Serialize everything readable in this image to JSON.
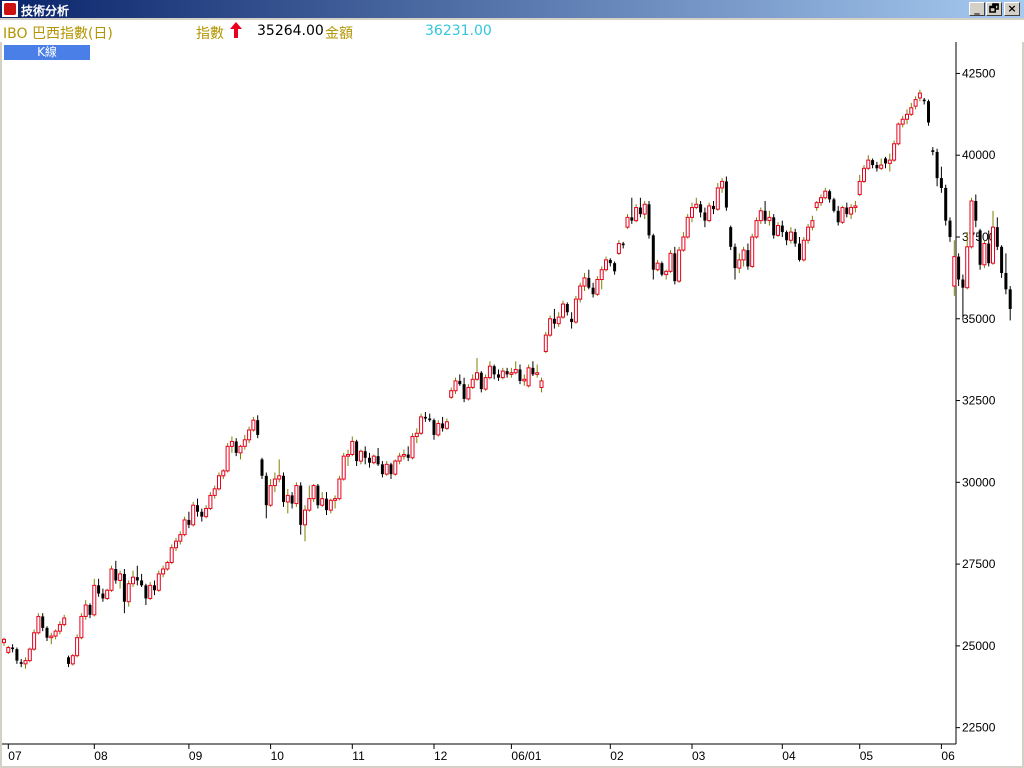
{
  "window": {
    "title": "技術分析"
  },
  "window_controls": [
    "_",
    "🗗",
    "×"
  ],
  "infobar": {
    "name": "IBO 巴西指數(日)",
    "index_label": "指數",
    "index_value": "35264.00",
    "amount_label": "金額",
    "amount_value": "36231.00"
  },
  "tab": {
    "label": "K線"
  },
  "colors": {
    "up": "#e8001e",
    "down": "#000000",
    "doji": "#808000",
    "label": "#b39500",
    "amount": "#33c6dd"
  },
  "chart_data": {
    "type": "candlestick",
    "title": "IBO 巴西指數(日)",
    "xlabel": "",
    "ylabel": "",
    "ylim": [
      22000,
      43400
    ],
    "y_ticks": [
      22500,
      25000,
      27500,
      30000,
      32500,
      35000,
      37500,
      40000,
      42500
    ],
    "y_axis_side": "right",
    "grid": false,
    "x_ticks": [
      "07",
      "08",
      "09",
      "10",
      "11",
      "12",
      "06/01",
      "02",
      "03",
      "04",
      "05",
      "06"
    ],
    "x_tick_index": [
      1,
      21,
      43,
      62,
      81,
      100,
      118,
      141,
      160,
      181,
      199,
      218
    ],
    "candles": [
      [
        25100,
        25250,
        25000,
        25200
      ],
      [
        24800,
        25000,
        24750,
        24950
      ],
      [
        24950,
        25050,
        24800,
        24900
      ],
      [
        24900,
        24950,
        24450,
        24550
      ],
      [
        24500,
        24600,
        24350,
        24450
      ],
      [
        24450,
        24650,
        24300,
        24550
      ],
      [
        24550,
        24950,
        24500,
        24900
      ],
      [
        24900,
        25500,
        24850,
        25400
      ],
      [
        25400,
        26000,
        25350,
        25900
      ],
      [
        25900,
        26000,
        25450,
        25550
      ],
      [
        25550,
        25600,
        25150,
        25250
      ],
      [
        25250,
        25400,
        25050,
        25300
      ],
      [
        25300,
        25500,
        25200,
        25450
      ],
      [
        25450,
        25750,
        25350,
        25650
      ],
      [
        25650,
        25950,
        25600,
        25850
      ],
      [
        24650,
        24700,
        24350,
        24450
      ],
      [
        24450,
        24750,
        24400,
        24700
      ],
      [
        24700,
        25350,
        24650,
        25250
      ],
      [
        25250,
        26000,
        25200,
        25900
      ],
      [
        25900,
        26400,
        25800,
        26250
      ],
      [
        26250,
        26300,
        25850,
        25950
      ],
      [
        25950,
        27050,
        25900,
        26850
      ],
      [
        26850,
        27050,
        26500,
        26600
      ],
      [
        26600,
        26750,
        26350,
        26450
      ],
      [
        26450,
        26750,
        26400,
        26700
      ],
      [
        26700,
        27450,
        26650,
        27350
      ],
      [
        27350,
        27600,
        26900,
        27000
      ],
      [
        27000,
        27300,
        26750,
        27200
      ],
      [
        27200,
        27350,
        26000,
        26350
      ],
      [
        26350,
        27000,
        26200,
        26900
      ],
      [
        26900,
        27300,
        26800,
        27100
      ],
      [
        27100,
        27450,
        26850,
        27000
      ],
      [
        27000,
        27200,
        26800,
        26850
      ],
      [
        26850,
        26900,
        26250,
        26450
      ],
      [
        26450,
        26950,
        26400,
        26850
      ],
      [
        26850,
        27000,
        26550,
        26700
      ],
      [
        26700,
        27300,
        26650,
        27200
      ],
      [
        27200,
        27450,
        27100,
        27350
      ],
      [
        27350,
        27600,
        27300,
        27550
      ],
      [
        27550,
        28100,
        27500,
        28000
      ],
      [
        28000,
        28300,
        27900,
        28200
      ],
      [
        28200,
        28500,
        28100,
        28400
      ],
      [
        28400,
        28950,
        28350,
        28850
      ],
      [
        28850,
        29100,
        28600,
        28700
      ],
      [
        28700,
        29400,
        28650,
        29300
      ],
      [
        29300,
        29500,
        28950,
        29100
      ],
      [
        29100,
        29200,
        28800,
        28950
      ],
      [
        28950,
        29300,
        28900,
        29200
      ],
      [
        29200,
        29700,
        29150,
        29600
      ],
      [
        29600,
        29900,
        29500,
        29800
      ],
      [
        29800,
        30300,
        29750,
        30200
      ],
      [
        30200,
        30400,
        30100,
        30350
      ],
      [
        30350,
        31200,
        30300,
        31100
      ],
      [
        31100,
        31400,
        30900,
        31250
      ],
      [
        31250,
        31350,
        30800,
        30900
      ],
      [
        30900,
        31150,
        30700,
        31100
      ],
      [
        31100,
        31450,
        31000,
        31300
      ],
      [
        31300,
        31700,
        31200,
        31600
      ],
      [
        31600,
        32000,
        31550,
        31900
      ],
      [
        31900,
        32050,
        31350,
        31450
      ],
      [
        30700,
        30750,
        30100,
        30200
      ],
      [
        30200,
        30300,
        28900,
        29300
      ],
      [
        29300,
        30100,
        29250,
        29900
      ],
      [
        29900,
        30300,
        29700,
        30100
      ],
      [
        30100,
        30700,
        30000,
        30200
      ],
      [
        30200,
        30300,
        29250,
        29400
      ],
      [
        29400,
        29800,
        29050,
        29600
      ],
      [
        29600,
        29700,
        29200,
        29350
      ],
      [
        29350,
        30000,
        29250,
        29900
      ],
      [
        29900,
        30000,
        28400,
        28700
      ],
      [
        28700,
        29300,
        28200,
        29150
      ],
      [
        29150,
        29900,
        29100,
        29500
      ],
      [
        29500,
        29950,
        29400,
        29900
      ],
      [
        29900,
        29950,
        29200,
        29300
      ],
      [
        29300,
        29700,
        29250,
        29500
      ],
      [
        29500,
        29700,
        29000,
        29150
      ],
      [
        29150,
        29500,
        29050,
        29450
      ],
      [
        29450,
        29600,
        29200,
        29500
      ],
      [
        29500,
        30200,
        29450,
        30100
      ],
      [
        30100,
        30900,
        30050,
        30800
      ],
      [
        30800,
        31000,
        30500,
        30850
      ],
      [
        30850,
        31400,
        30800,
        31250
      ],
      [
        31250,
        31300,
        30500,
        30650
      ],
      [
        30650,
        31000,
        30550,
        30950
      ],
      [
        30950,
        31100,
        30550,
        30750
      ],
      [
        30750,
        30900,
        30450,
        30600
      ],
      [
        30600,
        30850,
        30550,
        30800
      ],
      [
        30800,
        31050,
        30500,
        30550
      ],
      [
        30550,
        30650,
        30150,
        30250
      ],
      [
        30250,
        30650,
        30200,
        30550
      ],
      [
        30550,
        30600,
        30100,
        30250
      ],
      [
        30250,
        30700,
        30200,
        30650
      ],
      [
        30650,
        30900,
        30550,
        30800
      ],
      [
        30800,
        31000,
        30700,
        30850
      ],
      [
        30850,
        31100,
        30650,
        30750
      ],
      [
        30750,
        31500,
        30700,
        31400
      ],
      [
        31400,
        31650,
        31200,
        31500
      ],
      [
        31500,
        32100,
        31450,
        32000
      ],
      [
        32000,
        32150,
        31850,
        31950
      ],
      [
        31950,
        32100,
        31850,
        31900
      ],
      [
        31900,
        31950,
        31300,
        31450
      ],
      [
        31450,
        31900,
        31400,
        31800
      ],
      [
        31800,
        32000,
        31550,
        31650
      ],
      [
        31650,
        31950,
        31600,
        31850
      ],
      [
        32600,
        32900,
        32550,
        32800
      ],
      [
        32800,
        33200,
        32700,
        33100
      ],
      [
        33100,
        33300,
        32950,
        33000
      ],
      [
        33000,
        33200,
        32450,
        32550
      ],
      [
        32550,
        33000,
        32500,
        32900
      ],
      [
        32900,
        33300,
        32850,
        33150
      ],
      [
        33150,
        33800,
        33100,
        33350
      ],
      [
        33350,
        33400,
        32750,
        32850
      ],
      [
        32850,
        33300,
        32800,
        33200
      ],
      [
        33200,
        33700,
        33150,
        33550
      ],
      [
        33550,
        33600,
        33150,
        33300
      ],
      [
        33300,
        33450,
        33100,
        33200
      ],
      [
        33200,
        33500,
        33150,
        33400
      ],
      [
        33400,
        33500,
        33200,
        33300
      ],
      [
        33300,
        33500,
        33200,
        33350
      ],
      [
        33350,
        33700,
        33300,
        33450
      ],
      [
        33450,
        33600,
        33000,
        33100
      ],
      [
        33100,
        33300,
        32950,
        33150
      ],
      [
        32950,
        33600,
        32900,
        33500
      ],
      [
        33500,
        33700,
        33250,
        33300
      ],
      [
        33300,
        33600,
        33200,
        33350
      ],
      [
        32900,
        33200,
        32750,
        33100
      ],
      [
        34000,
        34600,
        33950,
        34500
      ],
      [
        34500,
        35100,
        34450,
        35000
      ],
      [
        35000,
        35300,
        34700,
        34850
      ],
      [
        34850,
        35200,
        34750,
        35050
      ],
      [
        35050,
        35550,
        35000,
        35450
      ],
      [
        35450,
        35500,
        35100,
        35200
      ],
      [
        35000,
        35200,
        34700,
        34900
      ],
      [
        34900,
        35700,
        34850,
        35600
      ],
      [
        35600,
        36100,
        35500,
        36000
      ],
      [
        36000,
        36400,
        35850,
        36250
      ],
      [
        36250,
        36500,
        35900,
        35950
      ],
      [
        35950,
        36100,
        35650,
        35750
      ],
      [
        35750,
        36300,
        35700,
        36200
      ],
      [
        36200,
        36600,
        35900,
        36500
      ],
      [
        36500,
        36900,
        36450,
        36800
      ],
      [
        36800,
        36850,
        36600,
        36700
      ],
      [
        36700,
        36750,
        36350,
        36450
      ],
      [
        37000,
        37400,
        36950,
        37300
      ],
      [
        37300,
        37350,
        37150,
        37250
      ],
      [
        37800,
        38200,
        37750,
        38100
      ],
      [
        38100,
        38700,
        37900,
        38000
      ],
      [
        38000,
        38500,
        37950,
        38400
      ],
      [
        38400,
        38700,
        38100,
        38200
      ],
      [
        38200,
        38600,
        38050,
        38500
      ],
      [
        38500,
        38600,
        37450,
        37550
      ],
      [
        37550,
        37600,
        36200,
        36500
      ],
      [
        36500,
        36800,
        36450,
        36700
      ],
      [
        36700,
        36750,
        36300,
        36350
      ],
      [
        36350,
        36500,
        36200,
        36450
      ],
      [
        36450,
        37100,
        36400,
        37000
      ],
      [
        37000,
        37200,
        36050,
        36150
      ],
      [
        36150,
        37200,
        36100,
        37100
      ],
      [
        37100,
        37650,
        37050,
        37500
      ],
      [
        37500,
        38200,
        37450,
        38100
      ],
      [
        38100,
        38550,
        37950,
        38400
      ],
      [
        38400,
        38700,
        38350,
        38500
      ],
      [
        38500,
        38600,
        38100,
        38250
      ],
      [
        38250,
        38400,
        37800,
        38000
      ],
      [
        38000,
        38550,
        37950,
        38450
      ],
      [
        38450,
        38600,
        38200,
        38350
      ],
      [
        38350,
        39150,
        38300,
        39000
      ],
      [
        39000,
        39300,
        38850,
        39200
      ],
      [
        39200,
        39350,
        38300,
        38400
      ],
      [
        37800,
        37850,
        37100,
        37200
      ],
      [
        37200,
        37300,
        36200,
        36550
      ],
      [
        36550,
        37000,
        36400,
        36800
      ],
      [
        36800,
        37200,
        36600,
        37100
      ],
      [
        37100,
        37300,
        36500,
        36600
      ],
      [
        36600,
        37600,
        36550,
        37500
      ],
      [
        37500,
        38100,
        37450,
        38000
      ],
      [
        38000,
        38400,
        37900,
        38300
      ],
      [
        38300,
        38600,
        37900,
        38000
      ],
      [
        38000,
        38300,
        37850,
        38100
      ],
      [
        38100,
        38200,
        37450,
        37550
      ],
      [
        37550,
        37950,
        37500,
        37850
      ],
      [
        37850,
        38000,
        37500,
        37650
      ],
      [
        37650,
        37700,
        37250,
        37400
      ],
      [
        37400,
        37800,
        37300,
        37650
      ],
      [
        37650,
        37750,
        37200,
        37300
      ],
      [
        37300,
        37500,
        36750,
        36800
      ],
      [
        36800,
        37500,
        36750,
        37400
      ],
      [
        37400,
        37900,
        37300,
        37800
      ],
      [
        37800,
        38150,
        37700,
        38000
      ],
      [
        38400,
        38600,
        38300,
        38550
      ],
      [
        38550,
        38800,
        38450,
        38700
      ],
      [
        38700,
        39000,
        38650,
        38900
      ],
      [
        38900,
        38950,
        38550,
        38650
      ],
      [
        38650,
        38700,
        38250,
        38300
      ],
      [
        38300,
        38450,
        37850,
        37950
      ],
      [
        37950,
        38450,
        37900,
        38400
      ],
      [
        38400,
        38550,
        38100,
        38200
      ],
      [
        38200,
        38500,
        38050,
        38400
      ],
      [
        38400,
        38600,
        38250,
        38450
      ],
      [
        38800,
        39400,
        38750,
        39200
      ],
      [
        39200,
        39700,
        39150,
        39600
      ],
      [
        39600,
        40000,
        39550,
        39850
      ],
      [
        39850,
        39900,
        39600,
        39700
      ],
      [
        39700,
        39800,
        39500,
        39600
      ],
      [
        39600,
        39900,
        39550,
        39700
      ],
      [
        39900,
        39950,
        39600,
        39750
      ],
      [
        39750,
        40050,
        39500,
        39850
      ],
      [
        39850,
        40450,
        39800,
        40350
      ],
      [
        40350,
        41000,
        40300,
        40950
      ],
      [
        40950,
        41200,
        40850,
        41100
      ],
      [
        41100,
        41400,
        40950,
        41250
      ],
      [
        41250,
        41600,
        41200,
        41450
      ],
      [
        41500,
        41800,
        41400,
        41700
      ],
      [
        41750,
        42000,
        41650,
        41900
      ],
      [
        41700,
        41750,
        41550,
        41650
      ],
      [
        41650,
        41700,
        40900,
        41000
      ],
      [
        40150,
        40250,
        40000,
        40100
      ],
      [
        40100,
        40200,
        39050,
        39300
      ],
      [
        39300,
        39650,
        38850,
        39000
      ],
      [
        39000,
        39100,
        37850,
        38000
      ],
      [
        38000,
        38100,
        37350,
        37500
      ],
      [
        36000,
        37400,
        35700,
        36900
      ],
      [
        36900,
        37000,
        36000,
        36200
      ],
      [
        36200,
        36350,
        34950,
        35950
      ],
      [
        35950,
        37650,
        35900,
        37200
      ],
      [
        37200,
        38700,
        37150,
        38600
      ],
      [
        38600,
        38800,
        37800,
        38000
      ],
      [
        37700,
        37750,
        36500,
        36650
      ],
      [
        36650,
        37400,
        36550,
        37300
      ],
      [
        37300,
        37700,
        36600,
        36700
      ],
      [
        36700,
        38300,
        36650,
        37800
      ],
      [
        37800,
        38100,
        37100,
        37200
      ],
      [
        37200,
        37250,
        36250,
        36400
      ],
      [
        36400,
        37000,
        35750,
        35900
      ],
      [
        35900,
        36000,
        34950,
        35300
      ]
    ]
  }
}
